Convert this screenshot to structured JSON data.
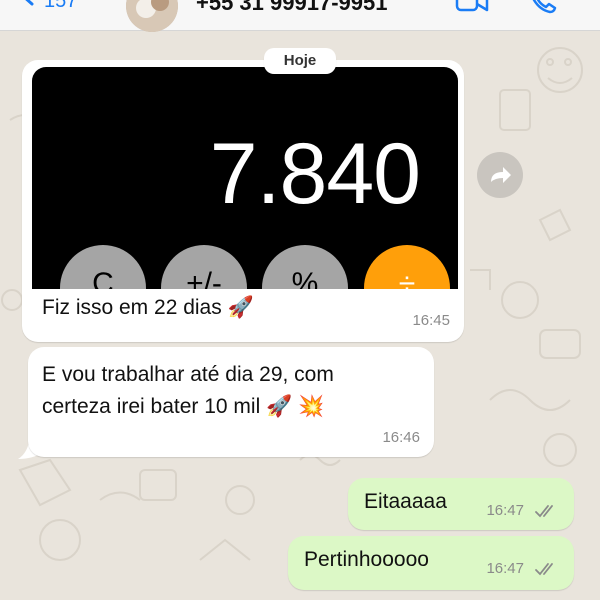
{
  "header": {
    "back_count": "157",
    "phone": "+55 31 99917-9951"
  },
  "date_separator": "Hoje",
  "messages": [
    {
      "direction": "incoming",
      "image": {
        "calculator_display": "7.840",
        "keys": [
          "C",
          "+/-",
          "%",
          "÷"
        ]
      },
      "caption": "Fiz isso em 22 dias 🚀",
      "time": "16:45"
    },
    {
      "direction": "incoming",
      "text_line1": "E vou trabalhar até dia 29, com",
      "text_line2": "certeza irei bater 10 mil 🚀 💥",
      "time": "16:46"
    },
    {
      "direction": "outgoing",
      "text": "Eitaaaaa",
      "time": "16:47",
      "status": "read"
    },
    {
      "direction": "outgoing",
      "text": "Pertinhooooo",
      "time": "16:47",
      "status": "read"
    }
  ],
  "colors": {
    "wallpaper": "#e9e4dc",
    "incoming_bubble": "#ffffff",
    "outgoing_bubble": "#dcf8c6",
    "accent": "#1a7cf5",
    "calc_orange": "#ff9f0a",
    "calc_gray": "#a5a5a5"
  },
  "icons": [
    "back-chevron-icon",
    "video-call-icon",
    "phone-call-icon",
    "forward-icon",
    "double-check-icon"
  ]
}
